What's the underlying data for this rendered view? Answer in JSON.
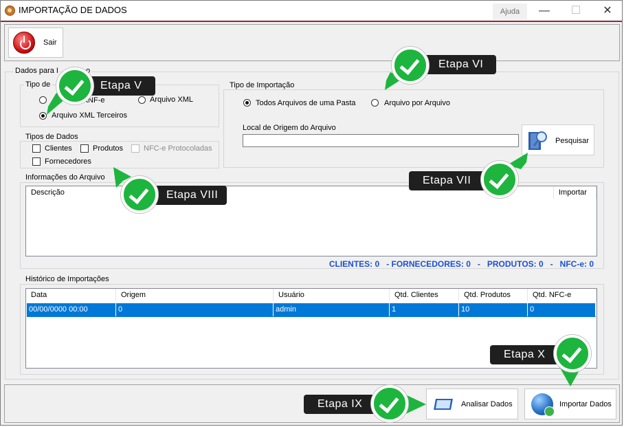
{
  "window": {
    "title": "IMPORTAÇÃO DE DADOS",
    "help_tab": "Ajuda",
    "min_symbol": "—",
    "max_symbol": "☐",
    "close_symbol": "✕"
  },
  "toolbar": {
    "exit_label": "Sair"
  },
  "dados_group": {
    "label": "Dados para Importação",
    "label_visible": "Dados para I",
    "label_suffix": "o"
  },
  "tipo_dados_group": {
    "label_visible": "Tipo de",
    "options": [
      {
        "label": "tNF-e",
        "selected": false
      },
      {
        "label": "Arquivo XML",
        "selected": false
      },
      {
        "label": "Arquivo XML Terceiros",
        "selected": true
      }
    ]
  },
  "tipos_de_dados": {
    "label": "Tipos de Dados",
    "items": [
      {
        "label": "Clientes",
        "checked": false,
        "enabled": true
      },
      {
        "label": "Produtos",
        "checked": false,
        "enabled": true
      },
      {
        "label": "NFC-e Protocoladas",
        "checked": false,
        "enabled": false
      },
      {
        "label": "Fornecedores",
        "checked": false,
        "enabled": true
      }
    ]
  },
  "tipo_importacao": {
    "label": "Tipo de Importação",
    "options": [
      {
        "label": "Todos Arquivos de uma Pasta",
        "selected": true
      },
      {
        "label": "Arquivo por Arquivo",
        "selected": false
      }
    ],
    "path_label": "Local de Origem do Arquivo",
    "path_value": "",
    "search_label": "Pesquisar"
  },
  "info_arquivo": {
    "label": "Informações do Arquivo",
    "columns": [
      "Descrição",
      "Importar"
    ],
    "rows": []
  },
  "summary": "CLIENTES: 0   - FORNECEDORES: 0   -   PRODUTOS: 0   -   NFC-e: 0",
  "historico": {
    "label": "Histórico de Importações",
    "columns": [
      "Data",
      "Origem",
      "Usuário",
      "Qtd. Clientes",
      "Qtd. Produtos",
      "Qtd. NFC-e"
    ],
    "rows": [
      [
        "00/00/0000 00:00",
        "0",
        "admin",
        "1",
        "10",
        "0"
      ]
    ]
  },
  "bottom": {
    "analyze_label": "Analisar Dados",
    "import_label": "Importar Dados"
  },
  "callouts": {
    "v": "Etapa V",
    "vi": "Etapa VI",
    "vii": "Etapa VII",
    "viii": "Etapa VIII",
    "ix": "Etapa IX",
    "x": "Etapa X"
  },
  "colors": {
    "accent_bar": "#8a2a3a",
    "selection": "#0078d7",
    "summary_text": "#1a4fd8",
    "callout_bg": "#1f1f1f",
    "check_green": "#1db53d"
  }
}
